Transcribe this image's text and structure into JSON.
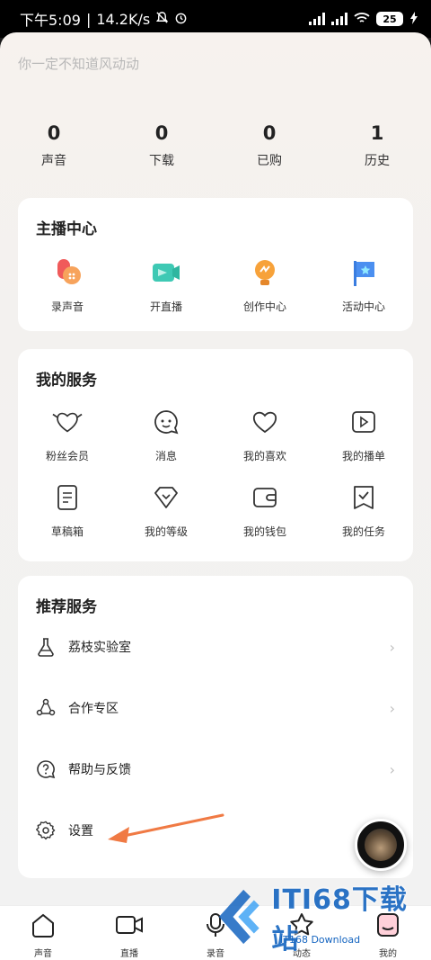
{
  "status_bar": {
    "time": "下午5:09",
    "speed": "14.2K/s",
    "battery": "25"
  },
  "profile": {
    "signature": "你一定不知道风动动"
  },
  "stats": [
    {
      "value": "0",
      "label": "声音"
    },
    {
      "value": "0",
      "label": "下载"
    },
    {
      "value": "0",
      "label": "已购"
    },
    {
      "value": "1",
      "label": "历史"
    }
  ],
  "anchor_center": {
    "title": "主播中心",
    "items": [
      {
        "label": "录声音",
        "icon": "record-voice-icon"
      },
      {
        "label": "开直播",
        "icon": "live-stream-icon"
      },
      {
        "label": "创作中心",
        "icon": "creation-center-icon"
      },
      {
        "label": "活动中心",
        "icon": "activity-center-icon"
      }
    ]
  },
  "my_services": {
    "title": "我的服务",
    "items": [
      {
        "label": "粉丝会员",
        "icon": "fan-member-icon"
      },
      {
        "label": "消息",
        "icon": "message-icon"
      },
      {
        "label": "我的喜欢",
        "icon": "heart-icon"
      },
      {
        "label": "我的播单",
        "icon": "playlist-icon"
      },
      {
        "label": "草稿箱",
        "icon": "drafts-icon"
      },
      {
        "label": "我的等级",
        "icon": "level-icon"
      },
      {
        "label": "我的钱包",
        "icon": "wallet-icon"
      },
      {
        "label": "我的任务",
        "icon": "task-icon"
      }
    ]
  },
  "recommended": {
    "title": "推荐服务",
    "items": [
      {
        "label": "荔枝实验室",
        "icon": "flask-icon"
      },
      {
        "label": "合作专区",
        "icon": "cooperation-icon"
      },
      {
        "label": "帮助与反馈",
        "icon": "help-icon"
      },
      {
        "label": "设置",
        "icon": "gear-icon"
      }
    ],
    "chevron": "›"
  },
  "tabbar": [
    {
      "label": "声音",
      "icon": "sound-tab-icon"
    },
    {
      "label": "直播",
      "icon": "live-tab-icon"
    },
    {
      "label": "录音",
      "icon": "mic-tab-icon"
    },
    {
      "label": "动态",
      "icon": "star-tab-icon"
    },
    {
      "label": "我的",
      "icon": "me-tab-icon"
    }
  ],
  "watermark": {
    "text": "ITI68下载站",
    "sub": "IT168 Download"
  },
  "colors": {
    "accent_orange": "#f07a44",
    "watermark_blue": "#1565c0"
  }
}
